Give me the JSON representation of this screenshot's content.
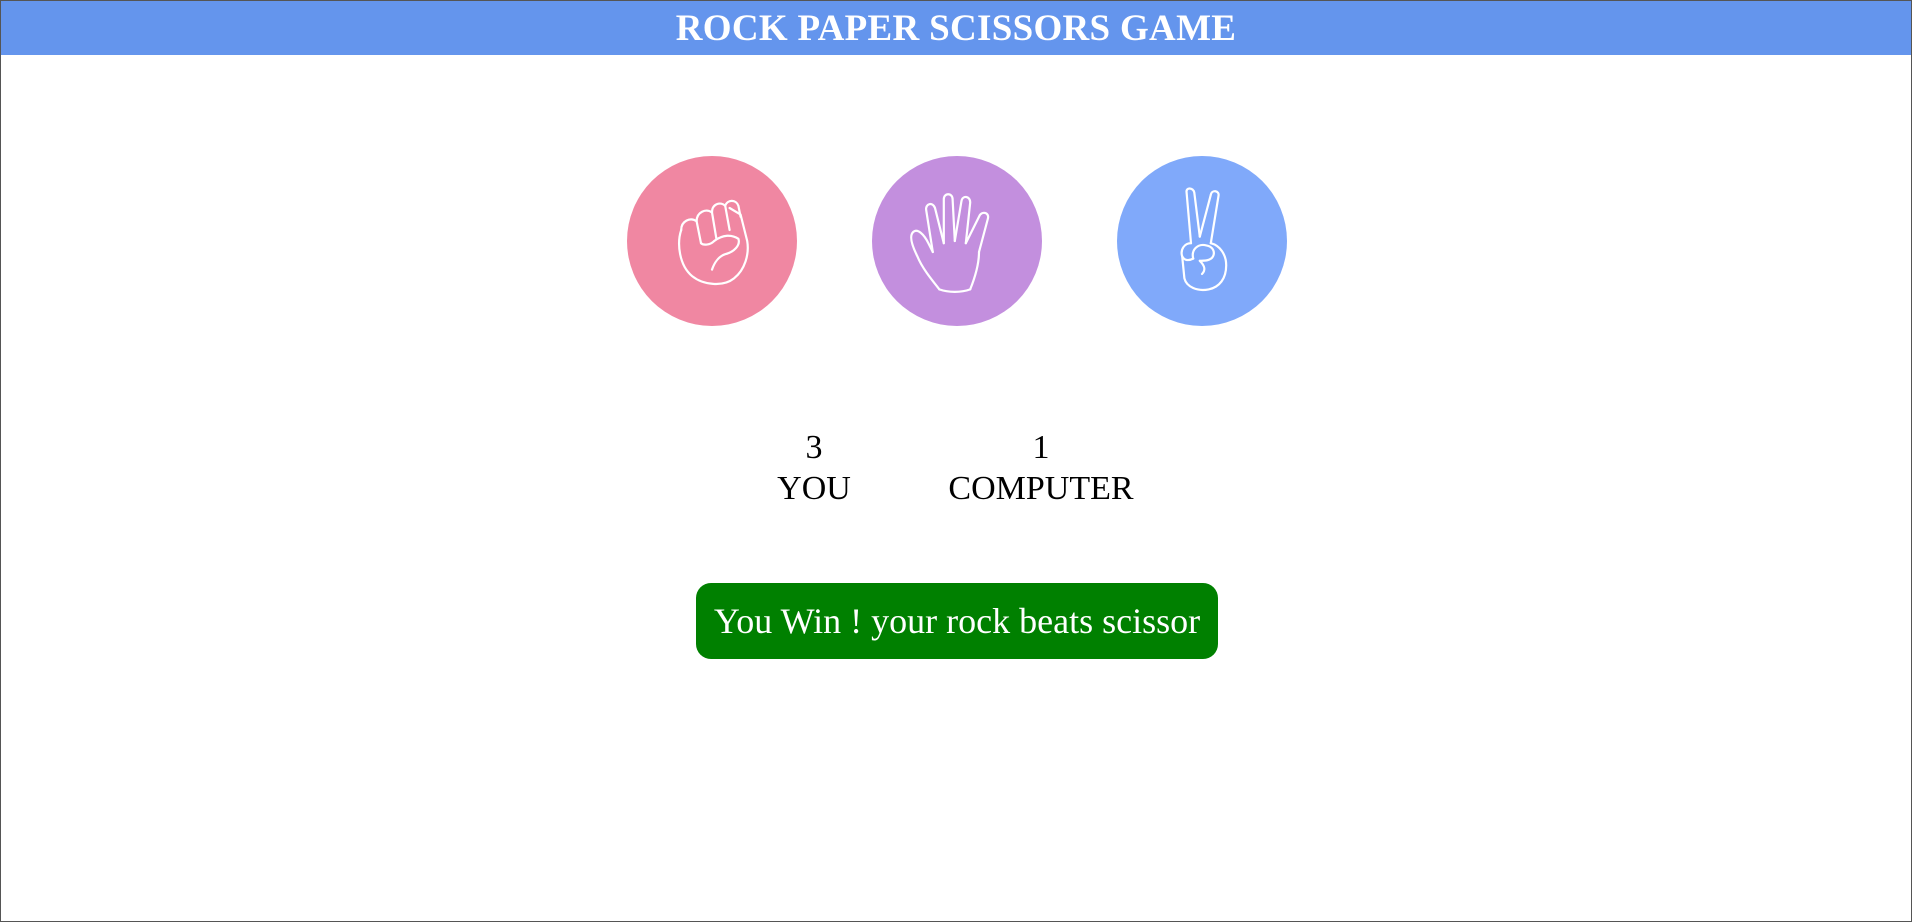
{
  "header": {
    "title": "ROCK PAPER SCISSORS GAME",
    "bg_color": "#6495ED"
  },
  "choices": [
    {
      "id": "rock",
      "icon": "fist-icon",
      "color": "#F087A2"
    },
    {
      "id": "paper",
      "icon": "open-hand-icon",
      "color": "#C38FDE"
    },
    {
      "id": "scissors",
      "icon": "peace-hand-icon",
      "color": "#80A9FA"
    }
  ],
  "scores": {
    "user": {
      "value": "3",
      "label": "YOU"
    },
    "computer": {
      "value": "1",
      "label": "COMPUTER"
    }
  },
  "message": {
    "text": "You Win ! your rock beats scissor",
    "bg_color": "#008000"
  }
}
